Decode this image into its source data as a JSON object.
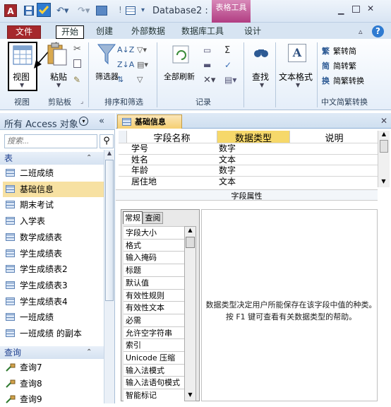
{
  "app": {
    "icon_letter": "A",
    "doc_title": "Database2 : ...",
    "context_tab_label": "表格工具"
  },
  "tabs": [
    "文件",
    "开始",
    "创建",
    "外部数据",
    "数据库工具",
    "设计"
  ],
  "ribbon": {
    "view_label": "视图",
    "paste_label": "粘贴",
    "filter_label": "筛选器",
    "refresh_label": "全部刷新",
    "find_label": "查找",
    "textfmt_label": "文本格式",
    "chinese": [
      "繁转简",
      "简转繁",
      "简繁转换"
    ],
    "groups": [
      "视图",
      "剪贴板",
      "排序和筛选",
      "记录",
      "中文简繁转换"
    ]
  },
  "nav": {
    "title": "所有 Access 对象",
    "search_placeholder": "搜索...",
    "tables_header": "表",
    "tables": [
      "二班成绩",
      "基础信息",
      "期末考试",
      "入学表",
      "数学成绩表",
      "学生成绩表",
      "学生成绩表2",
      "学生成绩表3",
      "学生成绩表4",
      "一班成绩",
      "一班成绩 的副本"
    ],
    "queries_header": "查询",
    "queries": [
      "查询7",
      "查询8",
      "查询9"
    ],
    "selected_index": 1
  },
  "doc": {
    "tab_label": "基础信息",
    "columns": [
      "字段名称",
      "数据类型",
      "说明"
    ],
    "rows": [
      {
        "name": "学号",
        "type": "数字"
      },
      {
        "name": "姓名",
        "type": "文本"
      },
      {
        "name": "年龄",
        "type": "数字"
      },
      {
        "name": "居住地",
        "type": "文本"
      }
    ],
    "field_props_title": "字段属性",
    "subtab_general": "常规",
    "subtab_lookup": "查阅",
    "props": [
      "字段大小",
      "格式",
      "输入掩码",
      "标题",
      "默认值",
      "有效性规则",
      "有效性文本",
      "必需",
      "允许空字符串",
      "索引",
      "Unicode 压缩",
      "输入法模式",
      "输入法语句模式",
      "智能标记"
    ],
    "help_text": "数据类型决定用户所能保存在该字段中值的种类。按 F1 键可查看有关数据类型的帮助。"
  },
  "colors": {
    "file_tab": "#a6282c",
    "context_tab": "#b13d82",
    "accent": "#2f7bd1",
    "doc_tab": "#f5cf72",
    "type_header": "#f6d86a"
  }
}
